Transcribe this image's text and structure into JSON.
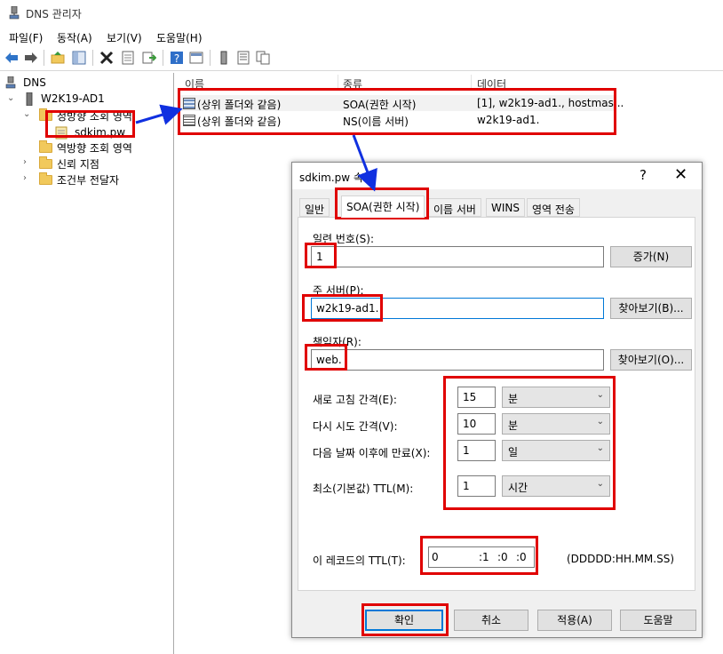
{
  "window": {
    "title": "DNS 관리자"
  },
  "menu": [
    {
      "label": "파일(F)"
    },
    {
      "label": "동작(A)"
    },
    {
      "label": "보기(V)"
    },
    {
      "label": "도움말(H)"
    }
  ],
  "tree": {
    "root": "DNS",
    "server": "W2K19-AD1",
    "forward_zones": "정방향 조회 영역",
    "zone": "sdkim.pw",
    "reverse_zones": "역방향 조회 영역",
    "trust_points": "신뢰 지점",
    "conditional_forwarders": "조건부 전달자"
  },
  "list": {
    "columns": [
      "이름",
      "종류",
      "데이터"
    ],
    "rows": [
      {
        "name": "(상위 폴더와 같음)",
        "type": "SOA(권한 시작)",
        "data": "[1], w2k19-ad1., hostmas..."
      },
      {
        "name": "(상위 폴더와 같음)",
        "type": "NS(이름 서버)",
        "data": "w2k19-ad1."
      }
    ]
  },
  "dialog": {
    "title": "sdkim.pw 속성",
    "help": "?",
    "close": "✕",
    "tabs": [
      "일반",
      "SOA(권한 시작)",
      "이름 서버",
      "WINS",
      "영역 전송"
    ],
    "serial": {
      "label": "일련 번호(S):",
      "value": "1",
      "button": "증가(N)"
    },
    "primary": {
      "label": "주 서버(P):",
      "value": "w2k19-ad1.",
      "button": "찾아보기(B)..."
    },
    "responsible": {
      "label": "책임자(R):",
      "value": "web.",
      "button": "찾아보기(O)..."
    },
    "intervals": [
      {
        "label": "새로 고침 간격(E):",
        "value": "15",
        "unit": "분"
      },
      {
        "label": "다시 시도 간격(V):",
        "value": "10",
        "unit": "분"
      },
      {
        "label": "다음 날짜 이후에 만료(X):",
        "value": "1",
        "unit": "일"
      },
      {
        "label": "최소(기본값) TTL(M):",
        "value": "1",
        "unit": "시간"
      }
    ],
    "ttl": {
      "label": "이 레코드의 TTL(T):",
      "days": "0",
      "hours": ":1",
      "minutes": ":0",
      "seconds": ":0",
      "format": "(DDDDD:HH.MM.SS)"
    },
    "buttons": {
      "ok": "확인",
      "cancel": "취소",
      "apply": "적용(A)",
      "help": "도움말"
    }
  },
  "colors": {
    "annotation_red": "#e00000",
    "annotation_arrow": "#1030e0",
    "focus_blue": "#0078d7"
  }
}
